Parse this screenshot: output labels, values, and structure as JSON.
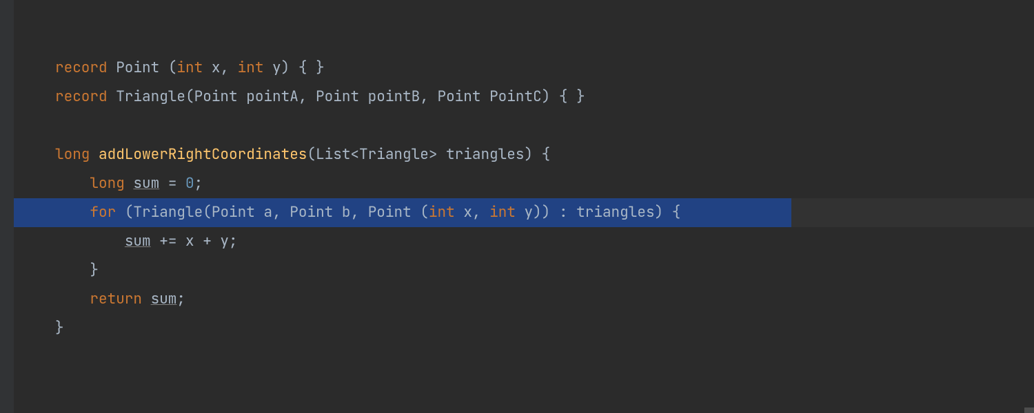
{
  "editor": {
    "colors": {
      "background": "#2B2B2B",
      "gutter": "#313335",
      "selection": "#214283",
      "text": "#A9B7C6",
      "keyword": "#CC7832",
      "number": "#6897BB",
      "method": "#FFC66D"
    },
    "selected_line_index": 5,
    "lines": [
      {
        "indent": 0,
        "tokens": [
          {
            "t": "record ",
            "c": "kw"
          },
          {
            "t": "Point ",
            "c": "type"
          },
          {
            "t": "(",
            "c": "punct"
          },
          {
            "t": "int ",
            "c": "kw"
          },
          {
            "t": "x",
            "c": "param"
          },
          {
            "t": ", ",
            "c": "punct"
          },
          {
            "t": "int ",
            "c": "kw"
          },
          {
            "t": "y",
            "c": "param"
          },
          {
            "t": ")",
            "c": "punct"
          },
          {
            "t": " { }",
            "c": "punct"
          }
        ]
      },
      {
        "indent": 0,
        "tokens": [
          {
            "t": "record ",
            "c": "kw"
          },
          {
            "t": "Triangle",
            "c": "type"
          },
          {
            "t": "(",
            "c": "punct"
          },
          {
            "t": "Point ",
            "c": "type"
          },
          {
            "t": "pointA",
            "c": "param"
          },
          {
            "t": ", ",
            "c": "punct"
          },
          {
            "t": "Point ",
            "c": "type"
          },
          {
            "t": "pointB",
            "c": "param"
          },
          {
            "t": ", ",
            "c": "punct"
          },
          {
            "t": "Point ",
            "c": "type"
          },
          {
            "t": "PointC",
            "c": "param"
          },
          {
            "t": ")",
            "c": "punct"
          },
          {
            "t": " { }",
            "c": "punct"
          }
        ]
      },
      {
        "indent": 0,
        "tokens": []
      },
      {
        "indent": 0,
        "tokens": [
          {
            "t": "long ",
            "c": "kw"
          },
          {
            "t": "addLowerRightCoordinates",
            "c": "method"
          },
          {
            "t": "(",
            "c": "punct"
          },
          {
            "t": "List",
            "c": "type"
          },
          {
            "t": "<",
            "c": "punct"
          },
          {
            "t": "Triangle",
            "c": "type"
          },
          {
            "t": ">",
            "c": "punct"
          },
          {
            "t": " triangles",
            "c": "param"
          },
          {
            "t": ")",
            "c": "punct"
          },
          {
            "t": " {",
            "c": "punct"
          }
        ]
      },
      {
        "indent": 1,
        "tokens": [
          {
            "t": "long ",
            "c": "kw"
          },
          {
            "t": "sum",
            "c": "ident under"
          },
          {
            "t": " = ",
            "c": "punct"
          },
          {
            "t": "0",
            "c": "num"
          },
          {
            "t": ";",
            "c": "punct"
          }
        ]
      },
      {
        "indent": 1,
        "tokens": [
          {
            "t": "for ",
            "c": "kw"
          },
          {
            "t": "(",
            "c": "punct"
          },
          {
            "t": "Triangle",
            "c": "type"
          },
          {
            "t": "(",
            "c": "punct"
          },
          {
            "t": "Point ",
            "c": "type"
          },
          {
            "t": "a",
            "c": "param"
          },
          {
            "t": ", ",
            "c": "punct"
          },
          {
            "t": "Point ",
            "c": "type"
          },
          {
            "t": "b",
            "c": "param"
          },
          {
            "t": ", ",
            "c": "punct"
          },
          {
            "t": "Point ",
            "c": "type"
          },
          {
            "t": "(",
            "c": "punct"
          },
          {
            "t": "int ",
            "c": "kw"
          },
          {
            "t": "x",
            "c": "param"
          },
          {
            "t": ", ",
            "c": "punct"
          },
          {
            "t": "int ",
            "c": "kw"
          },
          {
            "t": "y",
            "c": "param"
          },
          {
            "t": "))",
            "c": "punct"
          },
          {
            "t": " : ",
            "c": "punct"
          },
          {
            "t": "triangles",
            "c": "ident"
          },
          {
            "t": ")",
            "c": "punct"
          },
          {
            "t": " {",
            "c": "punct"
          }
        ]
      },
      {
        "indent": 2,
        "tokens": [
          {
            "t": "sum",
            "c": "ident under"
          },
          {
            "t": " += x + y;",
            "c": "ident"
          }
        ]
      },
      {
        "indent": 1,
        "tokens": [
          {
            "t": "}",
            "c": "punct"
          }
        ]
      },
      {
        "indent": 1,
        "tokens": [
          {
            "t": "return ",
            "c": "kw"
          },
          {
            "t": "sum",
            "c": "ident under"
          },
          {
            "t": ";",
            "c": "punct"
          }
        ]
      },
      {
        "indent": 0,
        "tokens": [
          {
            "t": "}",
            "c": "punct"
          }
        ]
      }
    ]
  }
}
